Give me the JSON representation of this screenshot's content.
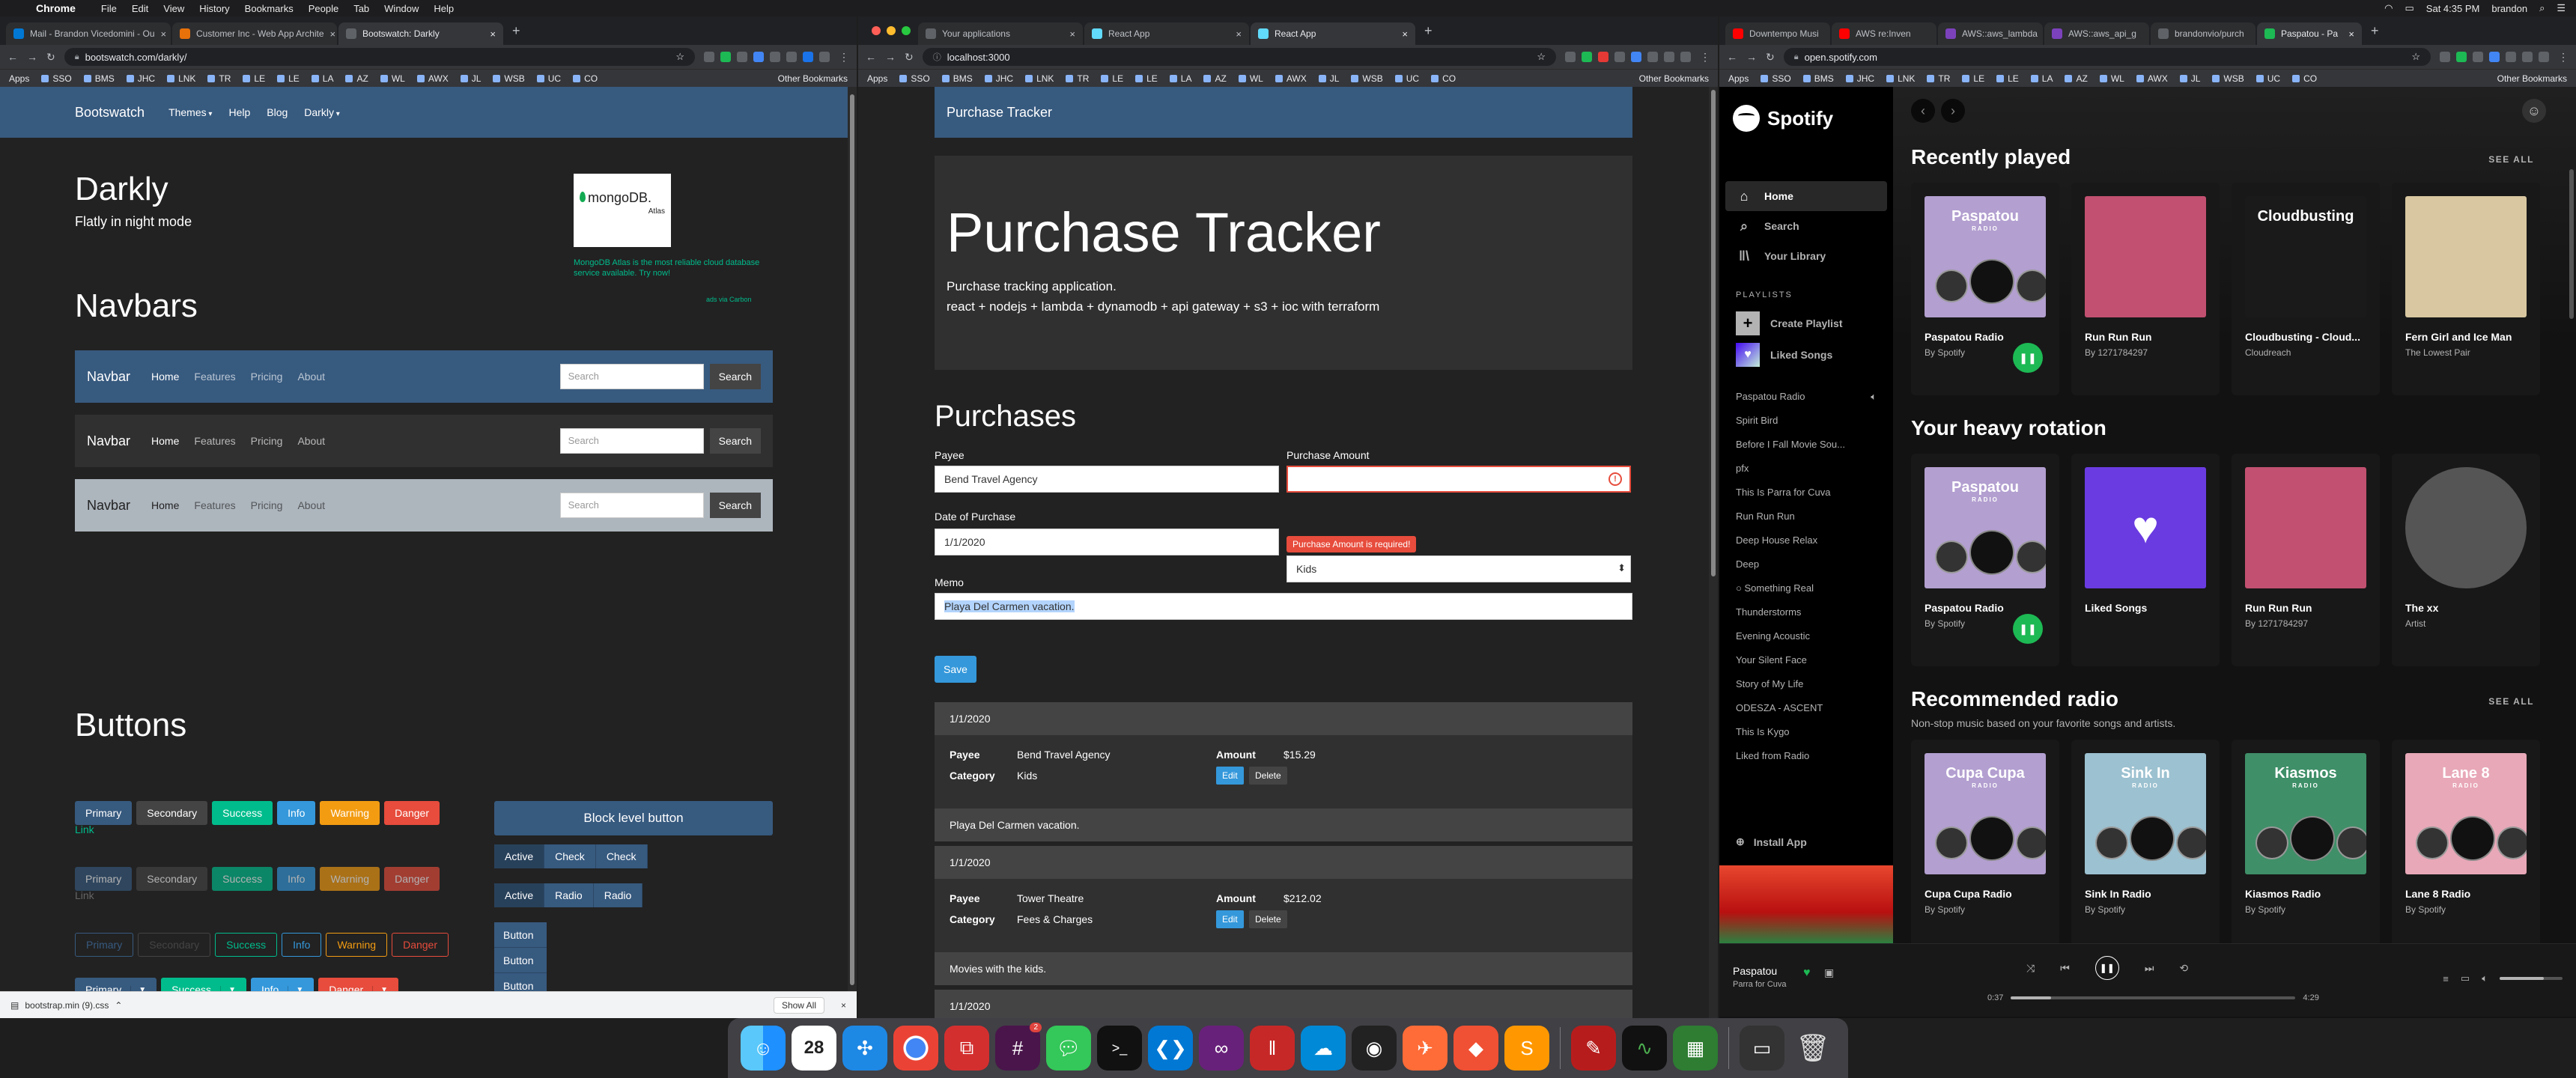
{
  "menubar": {
    "app": "Chrome",
    "items": [
      "File",
      "Edit",
      "View",
      "History",
      "Bookmarks",
      "People",
      "Tab",
      "Window",
      "Help"
    ],
    "clock": "Sat 4:35 PM",
    "user": "brandon"
  },
  "window1": {
    "tabs": [
      {
        "label": "Mail - Brandon Vicedomini - Ou",
        "color": "#0078d4"
      },
      {
        "label": "Customer Inc - Web App Archite",
        "color": "#e8710a"
      },
      {
        "label": "Bootswatch: Darkly",
        "color": "#5f6368"
      }
    ],
    "url": "bootswatch.com/darkly/",
    "bookmarks": [
      "Apps",
      "SSO",
      "BMS",
      "JHC",
      "LNK",
      "TR",
      "LE",
      "LE",
      "LA",
      "AZ",
      "WL",
      "AWX",
      "JL",
      "WSB",
      "UC",
      "CO"
    ],
    "other_bookmarks": "Other Bookmarks",
    "download": {
      "file": "bootstrap.min (9).css",
      "show_all": "Show All"
    },
    "page": {
      "nav": {
        "brand": "Bootswatch",
        "items": [
          "Themes",
          "Help",
          "Blog",
          "Darkly"
        ]
      },
      "hero": {
        "title": "Darkly",
        "subtitle": "Flatly in night mode"
      },
      "ad": {
        "logo": "mongoDB.",
        "logo_sub": "Atlas",
        "text": "MongoDB Atlas is the most reliable cloud database service available. Try now!",
        "via": "ads via Carbon"
      },
      "navbars_heading": "Navbars",
      "navbar_demo": {
        "brand": "Navbar",
        "items": [
          "Home",
          "Features",
          "Pricing",
          "About"
        ],
        "search_placeholder": "Search",
        "search_button": "Search"
      },
      "buttons_heading": "Buttons",
      "buttons": {
        "primary": "Primary",
        "secondary": "Secondary",
        "success": "Success",
        "info": "Info",
        "warning": "Warning",
        "danger": "Danger",
        "link": "Link",
        "block": "Block level button",
        "active": "Active",
        "check": "Check",
        "radio": "Radio",
        "button": "Button"
      }
    }
  },
  "window2": {
    "tabs": [
      {
        "label": "Your applications",
        "color": "#5f6368"
      },
      {
        "label": "React App",
        "color": "#61dafb"
      },
      {
        "label": "React App",
        "color": "#61dafb"
      }
    ],
    "url": "localhost:3000",
    "page": {
      "nav_title": "Purchase Tracker",
      "jumbo": {
        "title": "Purchase Tracker",
        "line1": "Purchase tracking application.",
        "line2": "react + nodejs + lambda + dynamodb + api gateway + s3 + ioc with terraform"
      },
      "form": {
        "heading": "Purchases",
        "payee_label": "Payee",
        "payee_value": "Bend Travel Agency",
        "amount_label": "Purchase Amount",
        "amount_value": "",
        "amount_error": "Purchase Amount is required!",
        "date_label": "Date of Purchase",
        "date_value": "1/1/2020",
        "category_value": "Kids",
        "memo_label": "Memo",
        "memo_value": "Playa Del Carmen vacation.",
        "save": "Save"
      },
      "purchases": [
        {
          "date": "1/1/2020",
          "payee": "Bend Travel Agency",
          "category": "Kids",
          "amount": "$15.29",
          "memo": "Playa Del Carmen vacation."
        },
        {
          "date": "1/1/2020",
          "payee": "Tower Theatre",
          "category": "Fees & Charges",
          "amount": "$212.02",
          "memo": "Movies with the kids."
        },
        {
          "date": "1/1/2020"
        }
      ],
      "labels": {
        "payee": "Payee",
        "category": "Category",
        "amount": "Amount",
        "edit": "Edit",
        "delete": "Delete"
      }
    }
  },
  "window3": {
    "tabs": [
      {
        "label": "Downtempo Musi",
        "color": "#ff0000"
      },
      {
        "label": "AWS re:Inven",
        "color": "#ff0000"
      },
      {
        "label": "AWS::aws_lambda",
        "color": "#7b42bc"
      },
      {
        "label": "AWS::aws_api_g",
        "color": "#7b42bc"
      },
      {
        "label": "brandonvio/purch",
        "color": "#5f6368"
      },
      {
        "label": "Paspatou - Pa",
        "color": "#1db954"
      }
    ],
    "url": "open.spotify.com",
    "page": {
      "logo": "Spotify",
      "nav": [
        "Home",
        "Search",
        "Your Library"
      ],
      "playlists_heading": "PLAYLISTS",
      "create_playlist": "Create Playlist",
      "liked_songs": "Liked Songs",
      "playlists": [
        "Paspatou Radio",
        "Spirit Bird",
        "Before I Fall Movie Sou...",
        "pfx",
        "This Is Parra for Cuva",
        "Run Run Run",
        "Deep House Relax",
        "Deep",
        "Something Real",
        "Thunderstorms",
        "Evening Acoustic",
        "Your Silent Face",
        "Story of My Life",
        "ODESZA - ASCENT",
        "This Is Kygo",
        "Liked from Radio"
      ],
      "install": "Install App",
      "see_all": "SEE ALL",
      "sections": [
        {
          "title": "Recently played",
          "subtitle": "",
          "cards": [
            {
              "title": "Paspatou Radio",
              "sub": "By Spotify",
              "color": "#b39fd0",
              "tag": "Paspatou",
              "playing": true
            },
            {
              "title": "Run Run Run",
              "sub": "By 1271784297",
              "color": "#c25070",
              "tag": ""
            },
            {
              "title": "Cloudbusting - Cloud...",
              "sub": "Cloudreach",
              "color": "#1a1a1a",
              "tag": "Cloudbusting"
            },
            {
              "title": "Fern Girl and Ice Man",
              "sub": "The Lowest Pair",
              "color": "#d8c7a0",
              "tag": ""
            }
          ]
        },
        {
          "title": "Your heavy rotation",
          "subtitle": "",
          "cards": [
            {
              "title": "Paspatou Radio",
              "sub": "By Spotify",
              "color": "#b39fd0",
              "tag": "Paspatou",
              "playing": true
            },
            {
              "title": "Liked Songs",
              "sub": "",
              "color": "#6a3be0",
              "tag": ""
            },
            {
              "title": "Run Run Run",
              "sub": "By 1271784297",
              "color": "#c25070",
              "tag": ""
            },
            {
              "title": "The xx",
              "sub": "Artist",
              "color": "#555",
              "tag": "",
              "round": true
            }
          ]
        },
        {
          "title": "Recommended radio",
          "subtitle": "Non-stop music based on your favorite songs and artists.",
          "cards": [
            {
              "title": "Cupa Cupa Radio",
              "sub": "By Spotify",
              "color": "#b39fd0",
              "tag": "Cupa Cupa"
            },
            {
              "title": "Sink In Radio",
              "sub": "By Spotify",
              "color": "#9cc1d0",
              "tag": "Sink In"
            },
            {
              "title": "Kiasmos Radio",
              "sub": "By Spotify",
              "color": "#3f8f68",
              "tag": "Kiasmos"
            },
            {
              "title": "Lane 8 Radio",
              "sub": "By Spotify",
              "color": "#e8a8b8",
              "tag": "Lane 8"
            }
          ]
        }
      ],
      "radio_tag": "RADIO",
      "player": {
        "title": "Paspatou",
        "artist": "Parra for Cuva",
        "elapsed": "0:37",
        "duration": "4:29",
        "progress": 0.14
      }
    }
  },
  "dock": [
    "Finder",
    "Calendar",
    "Safari",
    "Chrome",
    "Remote",
    "Slack",
    "Messages",
    "Terminal",
    "VS Code",
    "Visual Studio",
    "Parallels",
    "Azure",
    "GitHub",
    "Postman",
    "Git",
    "Sublime",
    "Acrobat",
    "Activity",
    "Numbers",
    "Screen",
    "Trash"
  ]
}
